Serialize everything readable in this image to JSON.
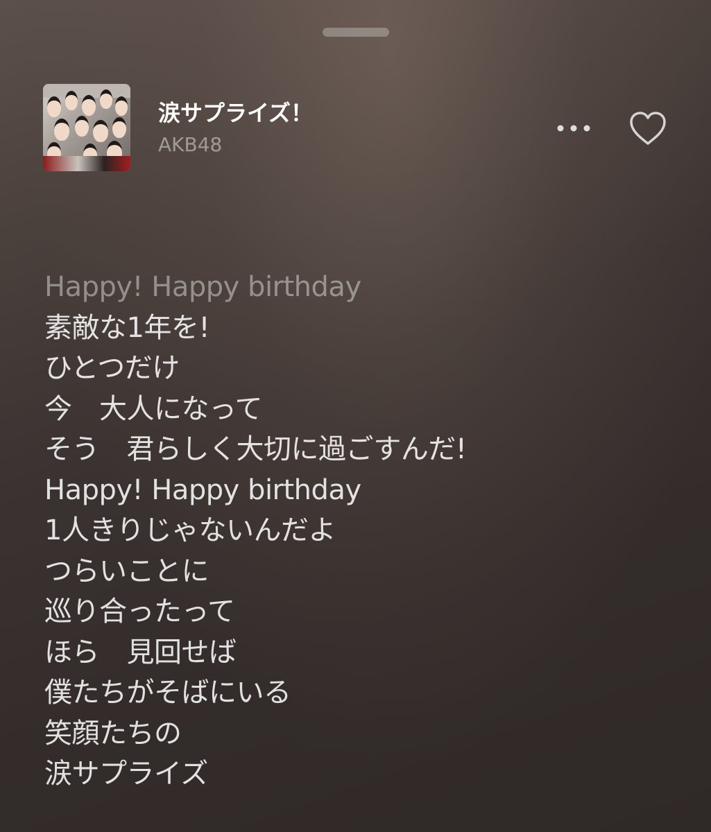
{
  "track": {
    "title": "涙サプライズ！",
    "artist": "AKB48"
  },
  "icons": {
    "more": "ellipsis-icon",
    "favorite": "heart-outline-icon"
  },
  "lyrics": [
    "Happy! Happy birthday",
    "素敵な1年を!",
    "ひとつだけ",
    "今　大人になって",
    "そう　君らしく大切に過ごすんだ!",
    "Happy! Happy birthday",
    "1人きりじゃないんだよ",
    "つらいことに",
    "巡り合ったって",
    "ほら　見回せば",
    "僕たちがそばにいる",
    "笑顔たちの",
    "涙サプライズ"
  ],
  "colors": {
    "background_top": "#5c504b",
    "background_bottom": "#2f2927",
    "lyric_active": "#ffffff",
    "lyric_dimmed": "#8f8783"
  }
}
